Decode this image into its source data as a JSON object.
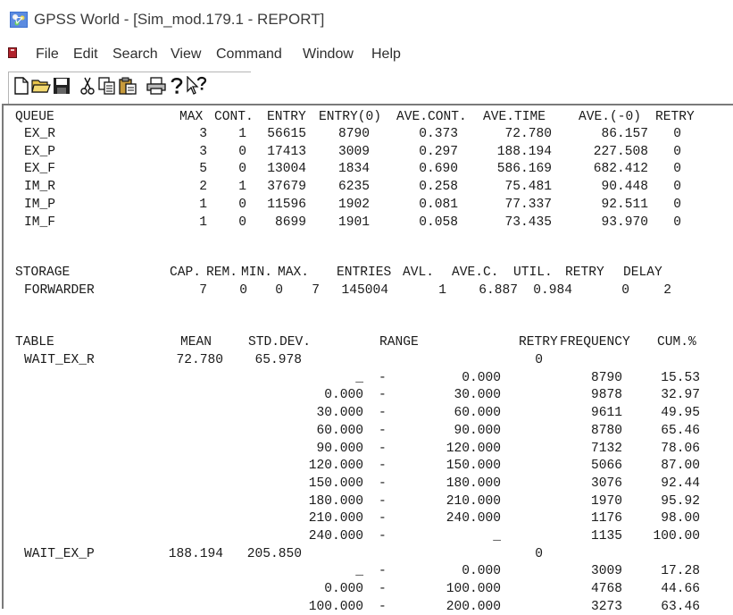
{
  "window": {
    "title": "GPSS World - [Sim_mod.179.1  -  REPORT]"
  },
  "menubar": {
    "items": [
      "File",
      "Edit",
      "Search",
      "View",
      "Command",
      "Window",
      "Help"
    ]
  },
  "toolbar": {
    "buttons": [
      "new-file-icon",
      "open-folder-icon",
      "save-disk-icon",
      "cut-icon",
      "copy-icon",
      "paste-icon",
      "print-icon",
      "help-icon",
      "context-help-icon"
    ]
  },
  "report": {
    "queue": {
      "header": [
        "QUEUE",
        "MAX",
        "CONT.",
        "ENTRY",
        "ENTRY(0)",
        "AVE.CONT.",
        "AVE.TIME",
        "AVE.(-0)",
        "RETRY"
      ],
      "rows": [
        [
          "EX_R",
          "3",
          "1",
          "56615",
          "8790",
          "0.373",
          "72.780",
          "86.157",
          "0"
        ],
        [
          "EX_P",
          "3",
          "0",
          "17413",
          "3009",
          "0.297",
          "188.194",
          "227.508",
          "0"
        ],
        [
          "EX_F",
          "5",
          "0",
          "13004",
          "1834",
          "0.690",
          "586.169",
          "682.412",
          "0"
        ],
        [
          "IM_R",
          "2",
          "1",
          "37679",
          "6235",
          "0.258",
          "75.481",
          "90.448",
          "0"
        ],
        [
          "IM_P",
          "1",
          "0",
          "11596",
          "1902",
          "0.081",
          "77.337",
          "92.511",
          "0"
        ],
        [
          "IM_F",
          "1",
          "0",
          "8699",
          "1901",
          "0.058",
          "73.435",
          "93.970",
          "0"
        ]
      ]
    },
    "storage": {
      "header": [
        "STORAGE",
        "CAP.",
        "REM.",
        "MIN.",
        "MAX.",
        "ENTRIES",
        "AVL.",
        "AVE.C.",
        "UTIL.",
        "RETRY",
        "DELAY"
      ],
      "rows": [
        [
          "FORWARDER",
          "7",
          "0",
          "0",
          "7",
          "145004",
          "1",
          "6.887",
          "0.984",
          "0",
          "2"
        ]
      ]
    },
    "table": {
      "header": [
        "TABLE",
        "MEAN",
        "STD.DEV.",
        "RANGE",
        "RETRY",
        "FREQUENCY",
        "CUM.%"
      ],
      "tables": [
        {
          "name": "WAIT_EX_R",
          "mean": "72.780",
          "stddev": "65.978",
          "retry": "0",
          "ranges": [
            [
              "_",
              "-",
              "0.000",
              "8790",
              "15.53"
            ],
            [
              "0.000",
              "-",
              "30.000",
              "9878",
              "32.97"
            ],
            [
              "30.000",
              "-",
              "60.000",
              "9611",
              "49.95"
            ],
            [
              "60.000",
              "-",
              "90.000",
              "8780",
              "65.46"
            ],
            [
              "90.000",
              "-",
              "120.000",
              "7132",
              "78.06"
            ],
            [
              "120.000",
              "-",
              "150.000",
              "5066",
              "87.00"
            ],
            [
              "150.000",
              "-",
              "180.000",
              "3076",
              "92.44"
            ],
            [
              "180.000",
              "-",
              "210.000",
              "1970",
              "95.92"
            ],
            [
              "210.000",
              "-",
              "240.000",
              "1176",
              "98.00"
            ],
            [
              "240.000",
              "-",
              "_",
              "1135",
              "100.00"
            ]
          ]
        },
        {
          "name": "WAIT_EX_P",
          "mean": "188.194",
          "stddev": "205.850",
          "retry": "0",
          "ranges": [
            [
              "_",
              "-",
              "0.000",
              "3009",
              "17.28"
            ],
            [
              "0.000",
              "-",
              "100.000",
              "4768",
              "44.66"
            ],
            [
              "100.000",
              "-",
              "200.000",
              "3273",
              "63.46"
            ]
          ]
        }
      ]
    }
  },
  "colors": {
    "text": "#1a1a1a",
    "title_text": "#3c3c3c",
    "background": "#ffffff",
    "border": "#7a7a7a"
  }
}
